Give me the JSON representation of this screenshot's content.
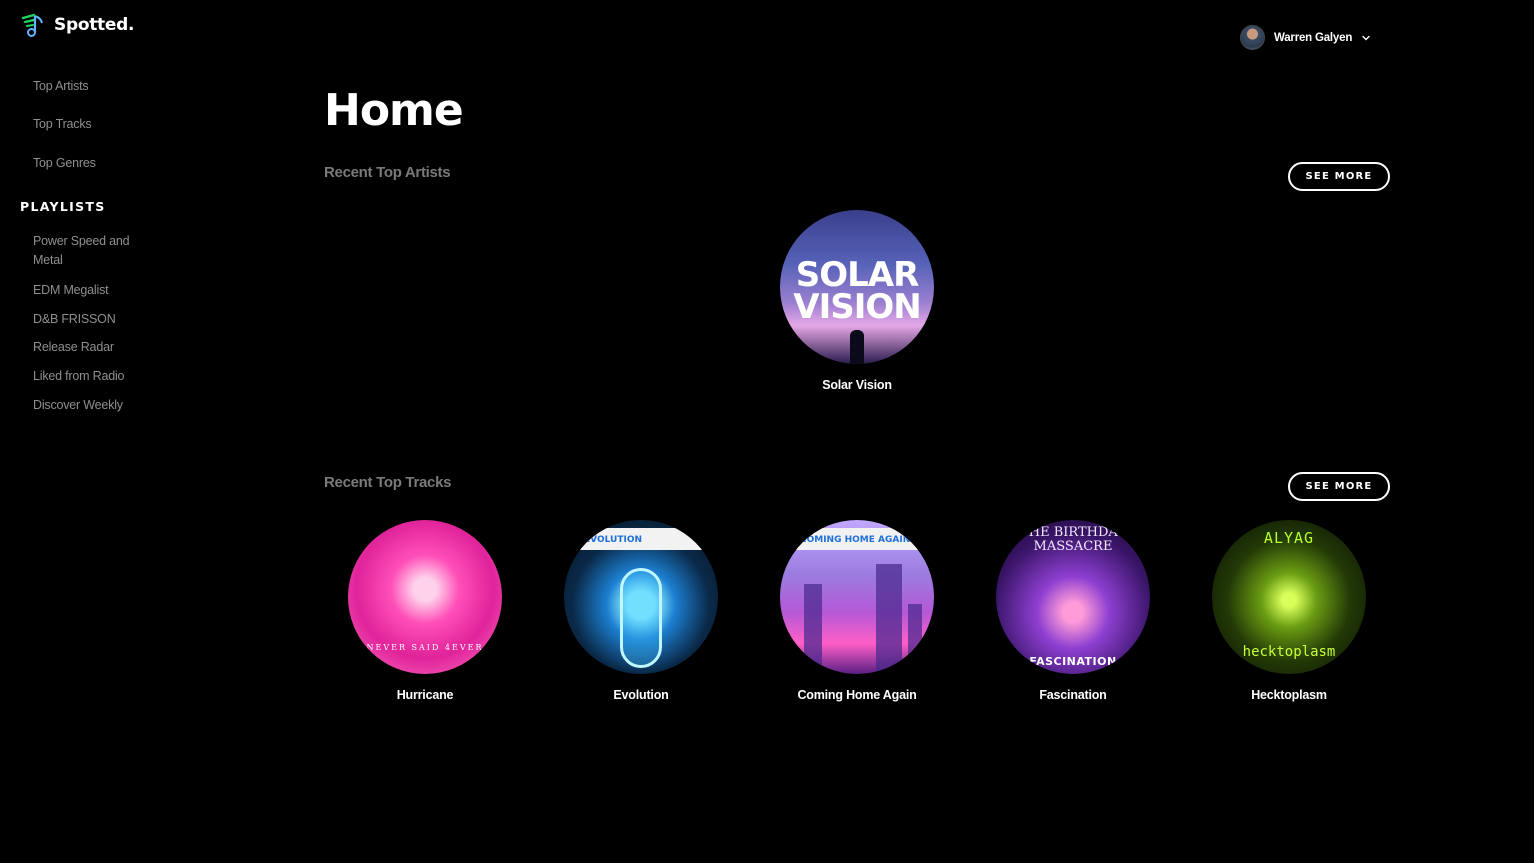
{
  "app": {
    "name": "Spotted."
  },
  "sidebar": {
    "items": [
      {
        "label": "Top Artists"
      },
      {
        "label": "Top Tracks"
      },
      {
        "label": "Top Genres"
      }
    ],
    "playlists_heading": "PLAYLISTS",
    "playlists": [
      {
        "label": "Power Speed and Metal"
      },
      {
        "label": "EDM Megalist"
      },
      {
        "label": "D&B FRISSON"
      },
      {
        "label": "Release Radar"
      },
      {
        "label": "Liked from Radio"
      },
      {
        "label": "Discover Weekly"
      }
    ]
  },
  "user": {
    "name": "Warren Galyen"
  },
  "main": {
    "title": "Home",
    "artists_section": {
      "title": "Recent Top Artists",
      "see_more": "SEE MORE",
      "items": [
        {
          "name": "Solar Vision",
          "art_text_1": "SOLAR",
          "art_text_2": "VISION"
        }
      ]
    },
    "tracks_section": {
      "title": "Recent Top Tracks",
      "see_more": "SEE MORE",
      "items": [
        {
          "name": "Hurricane",
          "art_text": "NEVER SAID 4EVER"
        },
        {
          "name": "Evolution",
          "art_text": "EVOLUTION"
        },
        {
          "name": "Coming Home Again",
          "art_text": "COMING HOME AGAIN"
        },
        {
          "name": "Fascination",
          "art_text_1": "THE BIRTHDAY MASSACRE",
          "art_text_2": "FASCINATION"
        },
        {
          "name": "Hecktoplasm",
          "art_text_1": "ALYAG",
          "art_text_2": "hecktoplasm"
        }
      ]
    }
  },
  "colors": {
    "background": "#000000",
    "muted_text": "#8f8f8f",
    "section_title": "#7a7a7a",
    "accent": "#1ed760"
  }
}
